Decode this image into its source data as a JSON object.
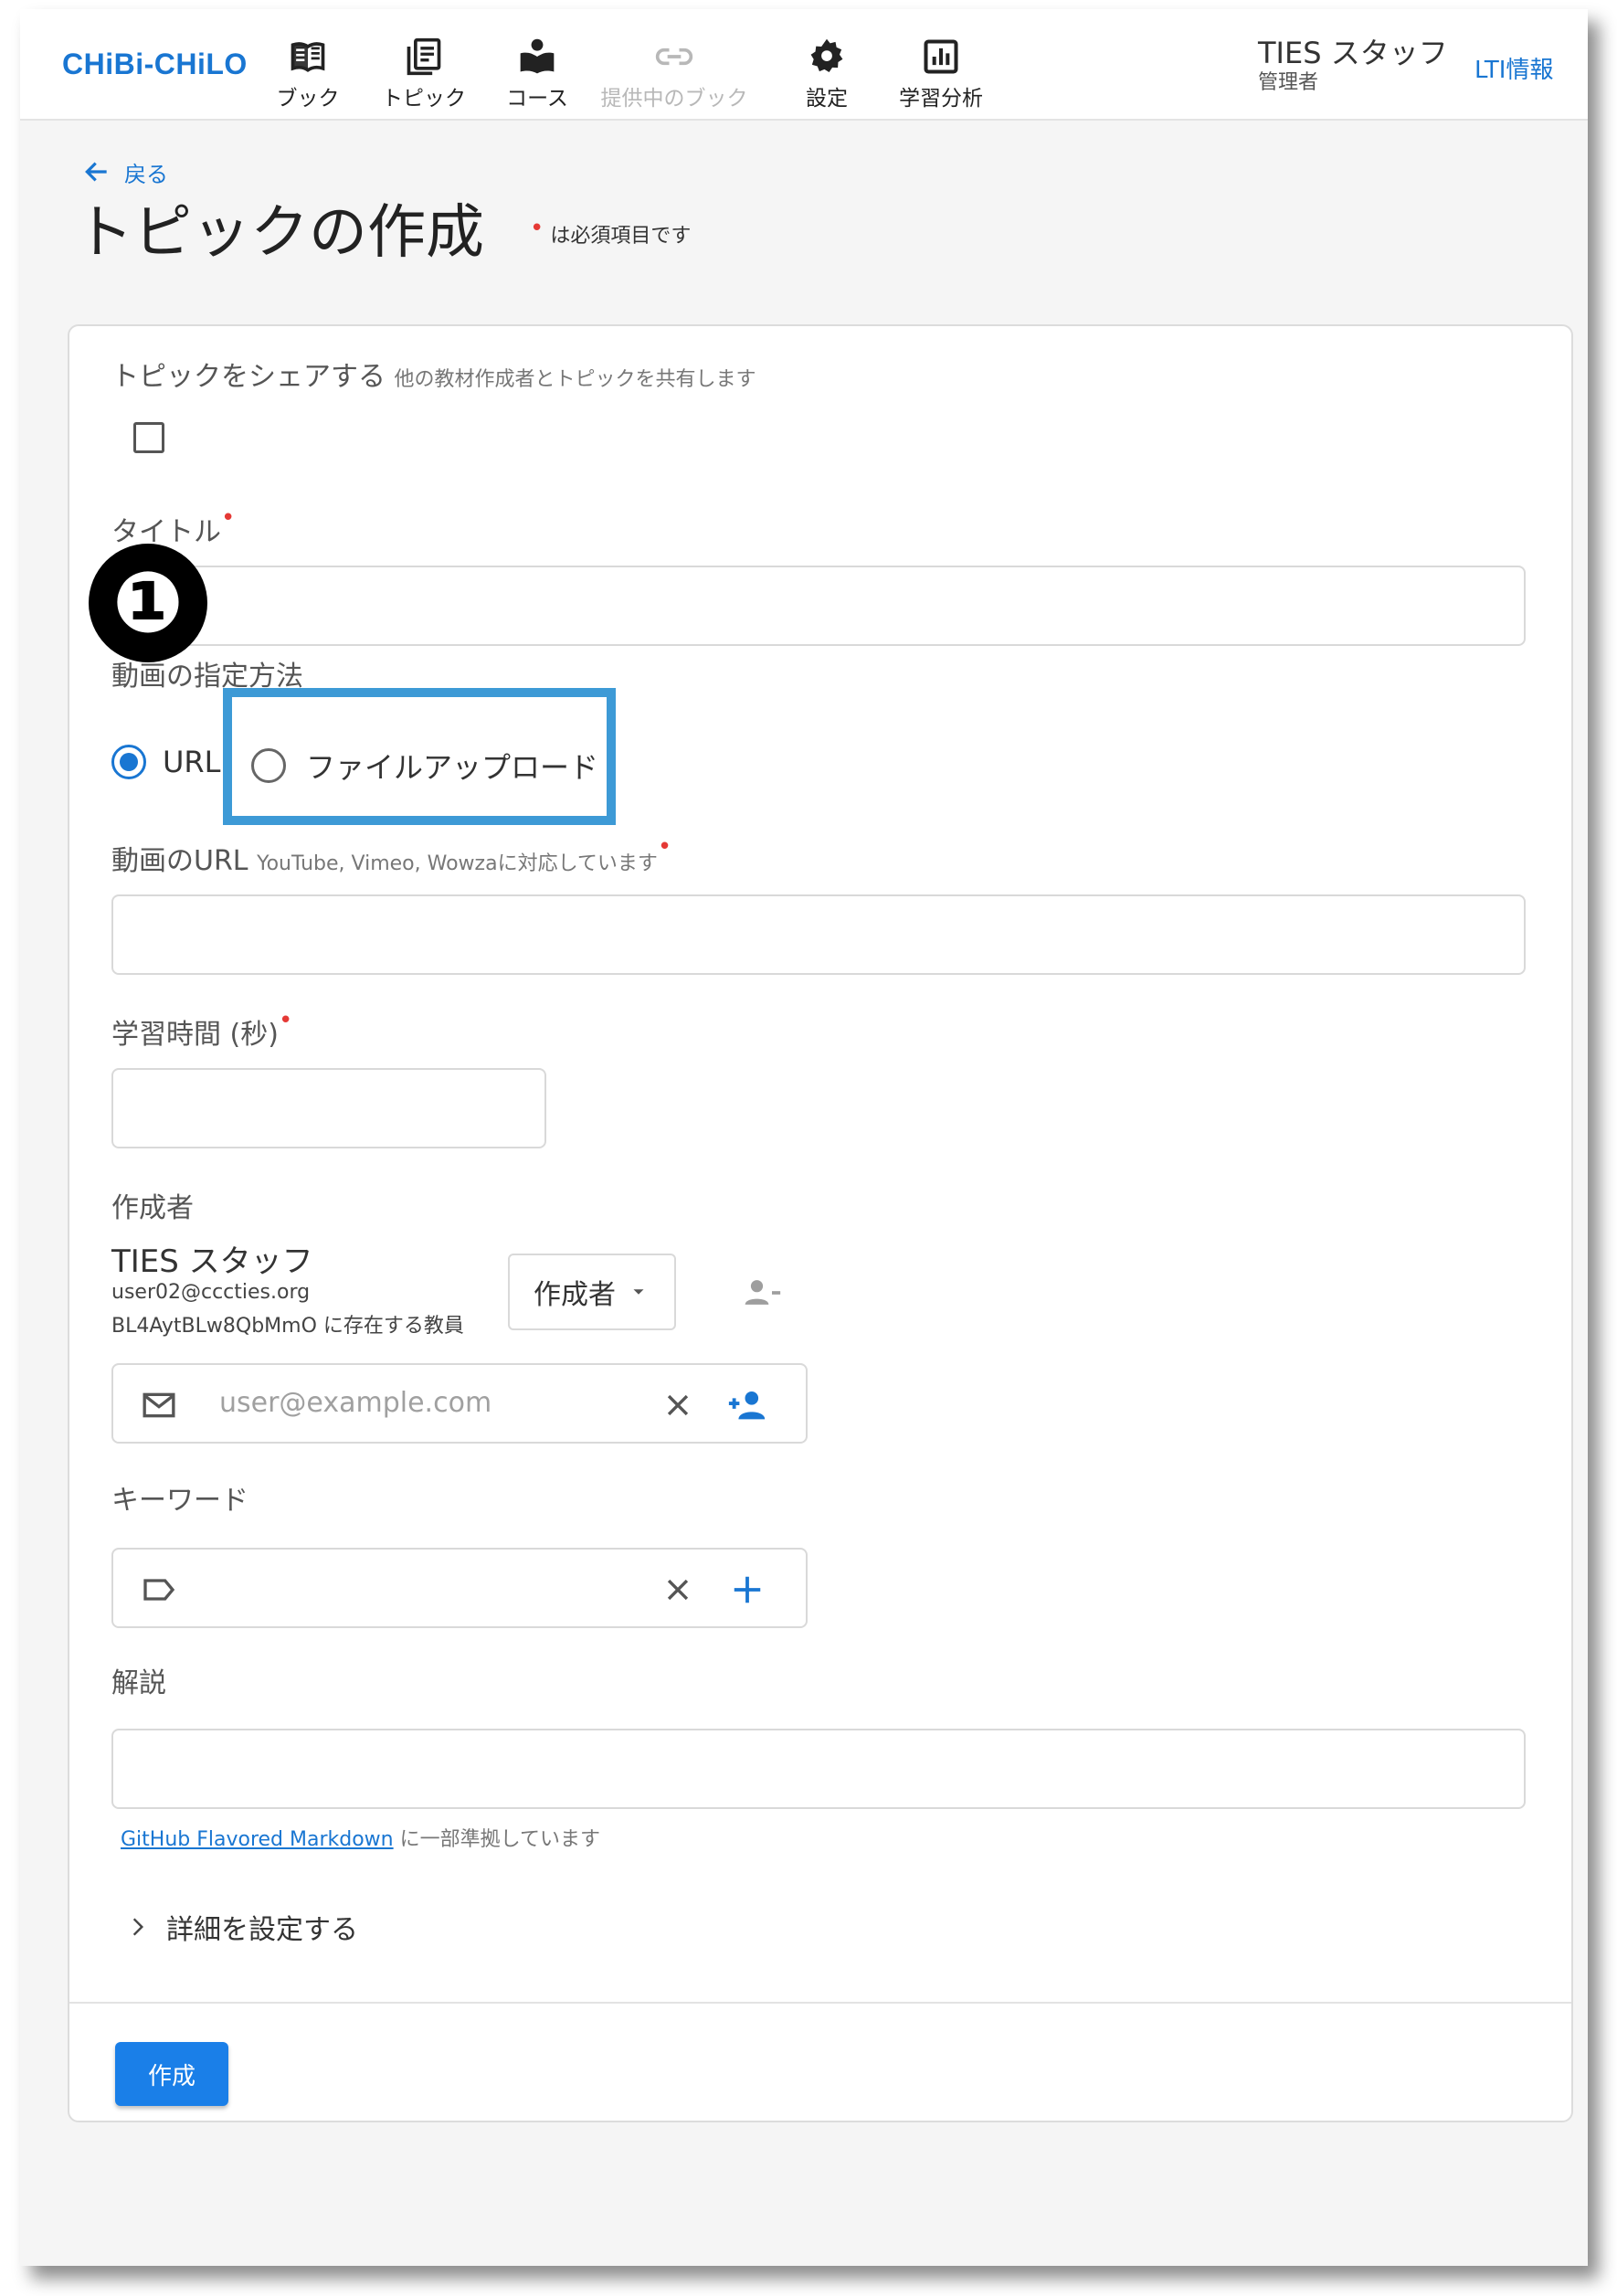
{
  "header": {
    "logo": "CHiBi-CHiLO",
    "nav": [
      {
        "label": "ブック",
        "icon": "book-icon"
      },
      {
        "label": "トピック",
        "icon": "topic-icon"
      },
      {
        "label": "コース",
        "icon": "course-icon"
      },
      {
        "label": "提供中のブック",
        "icon": "link-icon"
      },
      {
        "label": "設定",
        "icon": "gear-icon"
      },
      {
        "label": "学習分析",
        "icon": "analytics-icon"
      }
    ],
    "user_name": "TIES スタッフ",
    "user_role": "管理者",
    "lti_link": "LTI情報"
  },
  "page": {
    "back_label": "戻る",
    "title": "トピックの作成",
    "required_note": "は必須項目です"
  },
  "form": {
    "share": {
      "label": "トピックをシェアする",
      "hint": "他の教材作成者とトピックを共有します",
      "checked": false
    },
    "title_field": {
      "label": "タイトル",
      "value": ""
    },
    "video_method": {
      "label": "動画の指定方法",
      "options": [
        "URL",
        "ファイルアップロード"
      ],
      "selected": "URL"
    },
    "video_url": {
      "label": "動画のURL",
      "hint": "YouTube, Vimeo, Wowzaに対応しています",
      "value": ""
    },
    "study_time": {
      "label": "学習時間 (秒)",
      "value": ""
    },
    "authors": {
      "label": "作成者",
      "entries": [
        {
          "name": "TIES スタッフ",
          "email": "user02@cccties.org",
          "org": "BL4AytBLw8QbMmO に存在する教員",
          "role": "作成者"
        }
      ],
      "email_placeholder": "user@example.com"
    },
    "keywords": {
      "label": "キーワード",
      "value": ""
    },
    "description": {
      "label": "解説",
      "value": "",
      "markdown_link": "GitHub Flavored Markdown",
      "markdown_note": "に一部準拠しています"
    },
    "details_toggle": "詳細を設定する",
    "submit": "作成"
  },
  "annotation": {
    "step_number": "❶",
    "highlight_color": "#3d9ad6"
  },
  "colors": {
    "accent": "#1976d2",
    "required": "#e53935",
    "primary_button": "#1a7fe8"
  }
}
